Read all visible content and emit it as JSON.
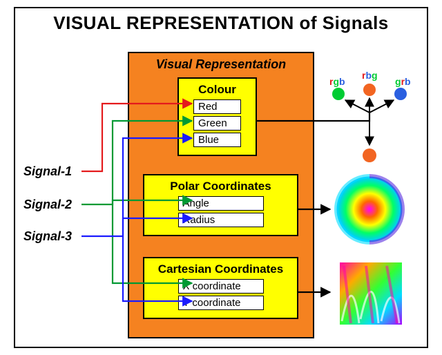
{
  "title": "VISUAL REPRESENTATION of Signals",
  "signals": {
    "s1": "Signal-1",
    "s2": "Signal-2",
    "s3": "Signal-3"
  },
  "panel": {
    "title": "Visual Representation",
    "colour": {
      "heading": "Colour",
      "red": "Red",
      "green": "Green",
      "blue": "Blue"
    },
    "polar": {
      "heading": "Polar Coordinates",
      "angle": "Angle",
      "radius": "Radius"
    },
    "cartesian": {
      "heading": "Cartesian Coordinates",
      "x": "X coordinate",
      "y": "Y coordinate"
    }
  },
  "permutations": {
    "p1": {
      "a": "r",
      "b": "g",
      "c": "b"
    },
    "p2": {
      "a": "r",
      "b": "b",
      "c": "g"
    },
    "p3": {
      "a": "g",
      "b": "r",
      "c": "b"
    }
  },
  "colors": {
    "red": "#e41a1c",
    "green": "#009933",
    "blue": "#1a1aff",
    "orange": "#f58220",
    "dotGreen": "#00cc33",
    "dotOrange": "#f26522",
    "dotBlue": "#2a5fe0"
  }
}
